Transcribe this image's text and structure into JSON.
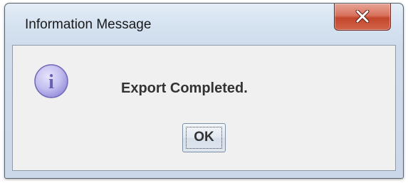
{
  "window": {
    "title": "Information Message"
  },
  "close_button": {
    "icon": "close-icon",
    "color": "#c94a32"
  },
  "dialog": {
    "icon": "info-icon",
    "icon_letter": "i",
    "icon_color": "#b8b3ea",
    "message": "Export Completed.",
    "ok_label": "OK"
  }
}
